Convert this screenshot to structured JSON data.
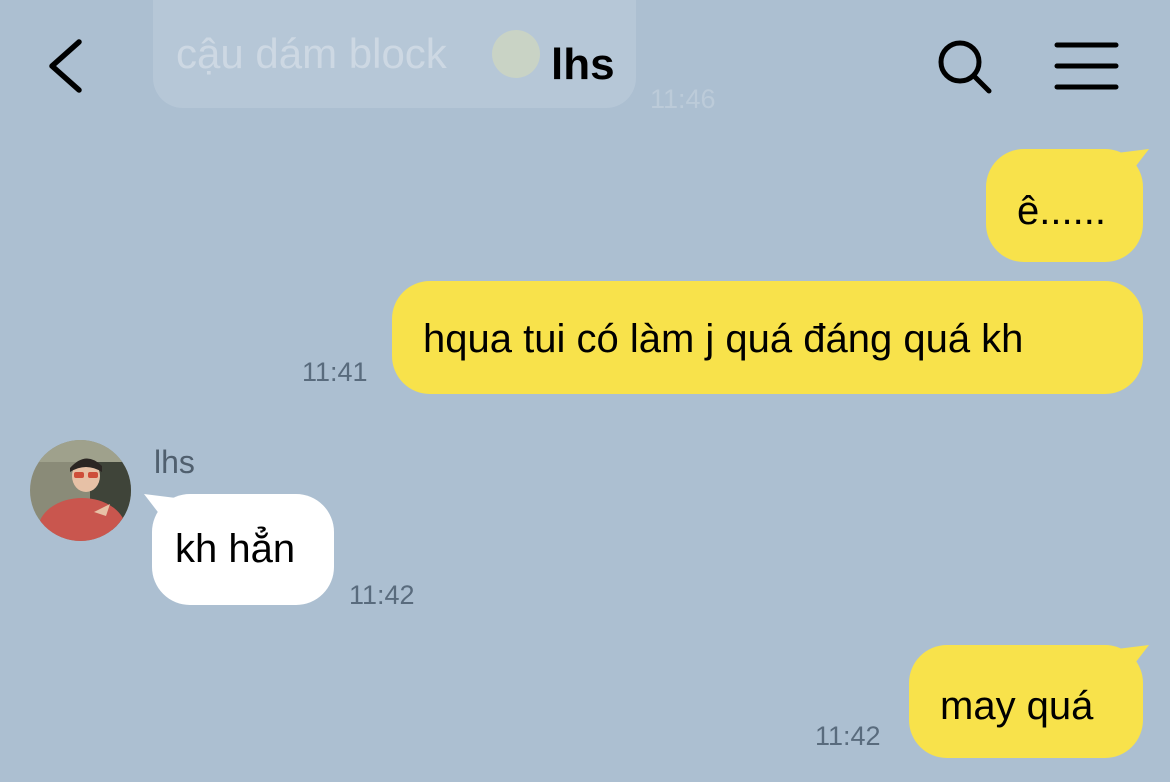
{
  "header": {
    "title": "lhs",
    "back_icon": "chevron-left-icon",
    "search_icon": "search-icon",
    "menu_icon": "hamburger-menu-icon",
    "pinned_preview": {
      "text": "cậu dám block",
      "emoji": "smiley-emoji-icon",
      "time": "11:46"
    }
  },
  "messages": [
    {
      "direction": "sent",
      "text": "ê......"
    },
    {
      "direction": "sent",
      "text": "hqua tui có làm j quá đáng quá kh",
      "time": "11:41"
    },
    {
      "direction": "received",
      "sender": "lhs",
      "text": "kh hẳn",
      "time": "11:42"
    },
    {
      "direction": "sent",
      "text": "may quá",
      "time": "11:42"
    }
  ],
  "colors": {
    "background": "#acbfd1",
    "sent_bubble": "#f8e24b",
    "received_bubble": "#ffffff"
  }
}
